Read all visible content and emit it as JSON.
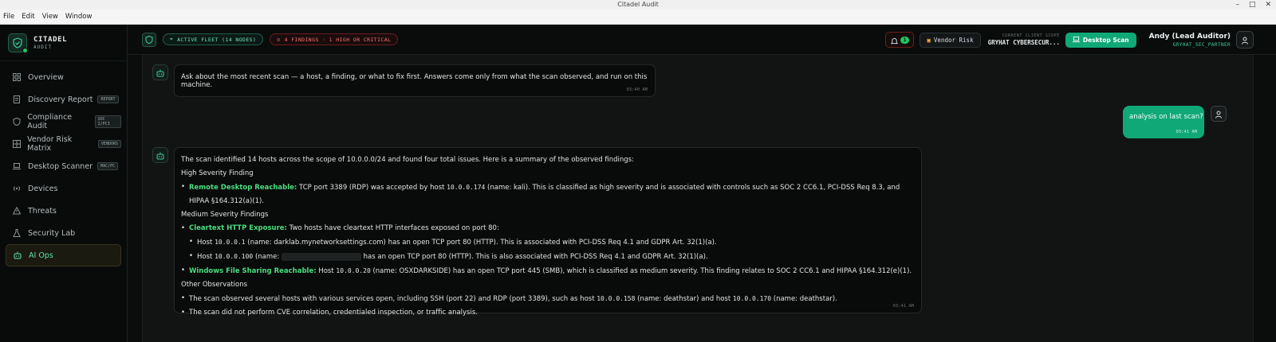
{
  "window": {
    "title": "Citadel Audit",
    "menu": [
      "File",
      "Edit",
      "View",
      "Window"
    ],
    "controls": [
      "–",
      "□",
      "✕"
    ]
  },
  "brand": {
    "name": "CITADEL",
    "sub": "AUDIT"
  },
  "sidebar": {
    "items": [
      {
        "label": "Overview",
        "icon": "grid-icon",
        "tag": ""
      },
      {
        "label": "Discovery Report",
        "icon": "document-icon",
        "tag": "REPORT"
      },
      {
        "label": "Compliance Audit",
        "icon": "shield-icon",
        "tag": "SOC 2/PCI"
      },
      {
        "label": "Vendor Risk Matrix",
        "icon": "matrix-icon",
        "tag": "VENDORS"
      },
      {
        "label": "Desktop Scanner",
        "icon": "laptop-icon",
        "tag": "MAC/PC"
      },
      {
        "label": "Devices",
        "icon": "broadcast-icon",
        "tag": ""
      },
      {
        "label": "Threats",
        "icon": "warning-icon",
        "tag": ""
      },
      {
        "label": "Security Lab",
        "icon": "flask-icon",
        "tag": ""
      },
      {
        "label": "AI Ops",
        "icon": "bot-icon",
        "tag": "",
        "active": true
      }
    ]
  },
  "topbar": {
    "fleet": "ACTIVE FLEET (14 NODES)",
    "findings": "4 FINDINGS · 1 HIGH OR CRITICAL",
    "notifications": "1",
    "vendor_risk": "Vendor Risk",
    "scope_label": "CURRENT CLIENT SCOPE",
    "scope_name": "GRYHAT CYBERSECUR...",
    "desktop_scan": "Desktop Scan",
    "user_name": "Andy (Lead Auditor)",
    "user_org": "GRYHAT_SEC_PARTNER"
  },
  "colors": {
    "accent": "#10a877",
    "highlight": "#4ade80",
    "danger": "#f87171"
  },
  "chat": {
    "intro": {
      "text": "Ask about the most recent scan — a host, a finding, or what to fix first. Answers come only from what the scan observed, and run on this machine.",
      "time": "03:40 AM"
    },
    "user": {
      "text": "analysis on last scan?",
      "time": "03:41 AM"
    },
    "reply": {
      "time": "03:41 AM",
      "summary": "The scan identified 14 hosts across the scope of 10.0.0.0/24 and found four total issues. Here is a summary of the observed findings:",
      "high_heading": "High Severity Finding",
      "rdp_title": "Remote Desktop Reachable:",
      "rdp_a": "TCP port 3389 (RDP) was accepted by host",
      "rdp_ip": "10.0.0.174",
      "rdp_b": "(name: kali). This is classified as high severity and is associated with controls such as SOC 2 CC6.1, PCI-DSS Req 8.3, and HIPAA §164.312(a)(1).",
      "medium_heading": "Medium Severity Findings",
      "http_title": "Cleartext HTTP Exposure:",
      "http_text": "Two hosts have cleartext HTTP interfaces exposed on port 80:",
      "host1_pre": "Host",
      "host1_ip": "10.0.0.1",
      "host1_text": "(name: darklab.mynetworksettings.com) has an open TCP port 80 (HTTP). This is associated with PCI-DSS Req 4.1 and GDPR Art. 32(1)(a).",
      "host2_pre": "Host",
      "host2_ip": "10.0.0.100",
      "host2_name": "(name:",
      "host2_text": "has an open TCP port 80 (HTTP). This is also associated with PCI-DSS Req 4.1 and GDPR Art. 32(1)(a).",
      "smb_title": "Windows File Sharing Reachable:",
      "smb_a": "Host",
      "smb_ip": "10.0.0.20",
      "smb_b": "(name: OSXDARKSIDE) has an open TCP port 445 (SMB), which is classified as medium severity. This finding relates to SOC 2 CC6.1 and HIPAA §164.312(e)(1).",
      "other_heading": "Other Observations",
      "obs1_a": "The scan observed several hosts with various services open, including SSH (port 22) and RDP (port 3389), such as host",
      "obs1_ip1": "10.0.0.158",
      "obs1_b": "(name: deathstar) and host",
      "obs1_ip2": "10.0.0.170",
      "obs1_c": "(name: deathstar).",
      "obs2": "The scan did not perform CVE correlation, credentialed inspection, or traffic analysis."
    }
  }
}
